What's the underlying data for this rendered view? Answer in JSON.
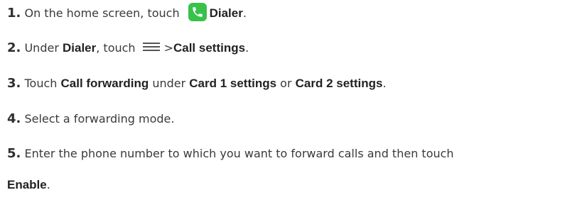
{
  "steps": [
    {
      "num": "1.",
      "t1": "On the home screen, touch",
      "icon": "phone-icon",
      "b1": "Dialer",
      "t2": "."
    },
    {
      "num": "2.",
      "t1": "Under",
      "b1": "Dialer",
      "t2": ", touch",
      "icon": "menu-icon",
      "t3": ">",
      "b2": "Call settings",
      "t4": "."
    },
    {
      "num": "3.",
      "t1": "Touch",
      "b1": "Call forwarding",
      "t2": "under",
      "b2": "Card 1 settings",
      "t3": "or",
      "b3": "Card 2 settings",
      "t4": "."
    },
    {
      "num": "4.",
      "t1": "Select a forwarding mode."
    },
    {
      "num": "5.",
      "t1": "Enter the phone number to which you want to forward calls and then touch",
      "b1": "Enable",
      "t2": "."
    }
  ],
  "colors": {
    "phone_icon_bg": "#39c24a",
    "text": "#3a3a3a"
  }
}
